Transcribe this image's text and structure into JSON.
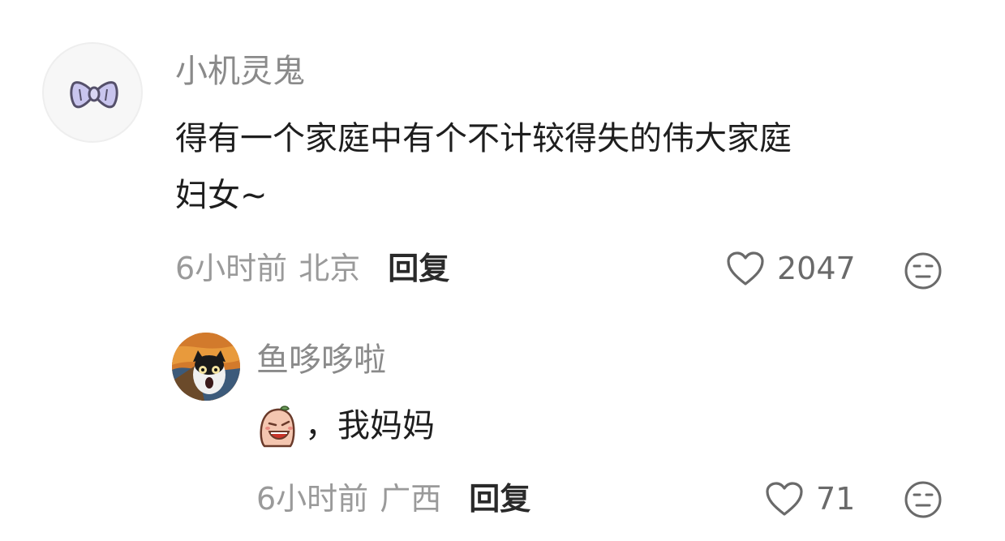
{
  "comments": [
    {
      "username": "小机灵鬼",
      "avatar_icon": "bow-icon",
      "text_line1": "得有一个家庭中有个不计较得失的伟大家庭",
      "text_line2": "妇女~",
      "time": "6小时前",
      "location": "北京",
      "reply_label": "回复",
      "like_count": "2047"
    },
    {
      "username": "鱼哆哆啦",
      "avatar_icon": "scream-cat-avatar",
      "sticker_icon": "crying-face-sticker",
      "text": "，我妈妈",
      "time": "6小时前",
      "location": "广西",
      "reply_label": "回复",
      "like_count": "71"
    }
  ],
  "colors": {
    "username": "#8a8a8a",
    "body": "#1e1e1e",
    "meta": "#9a9a9a",
    "reply": "#2a2a2a",
    "accent_bow": "#b8b4e6"
  }
}
